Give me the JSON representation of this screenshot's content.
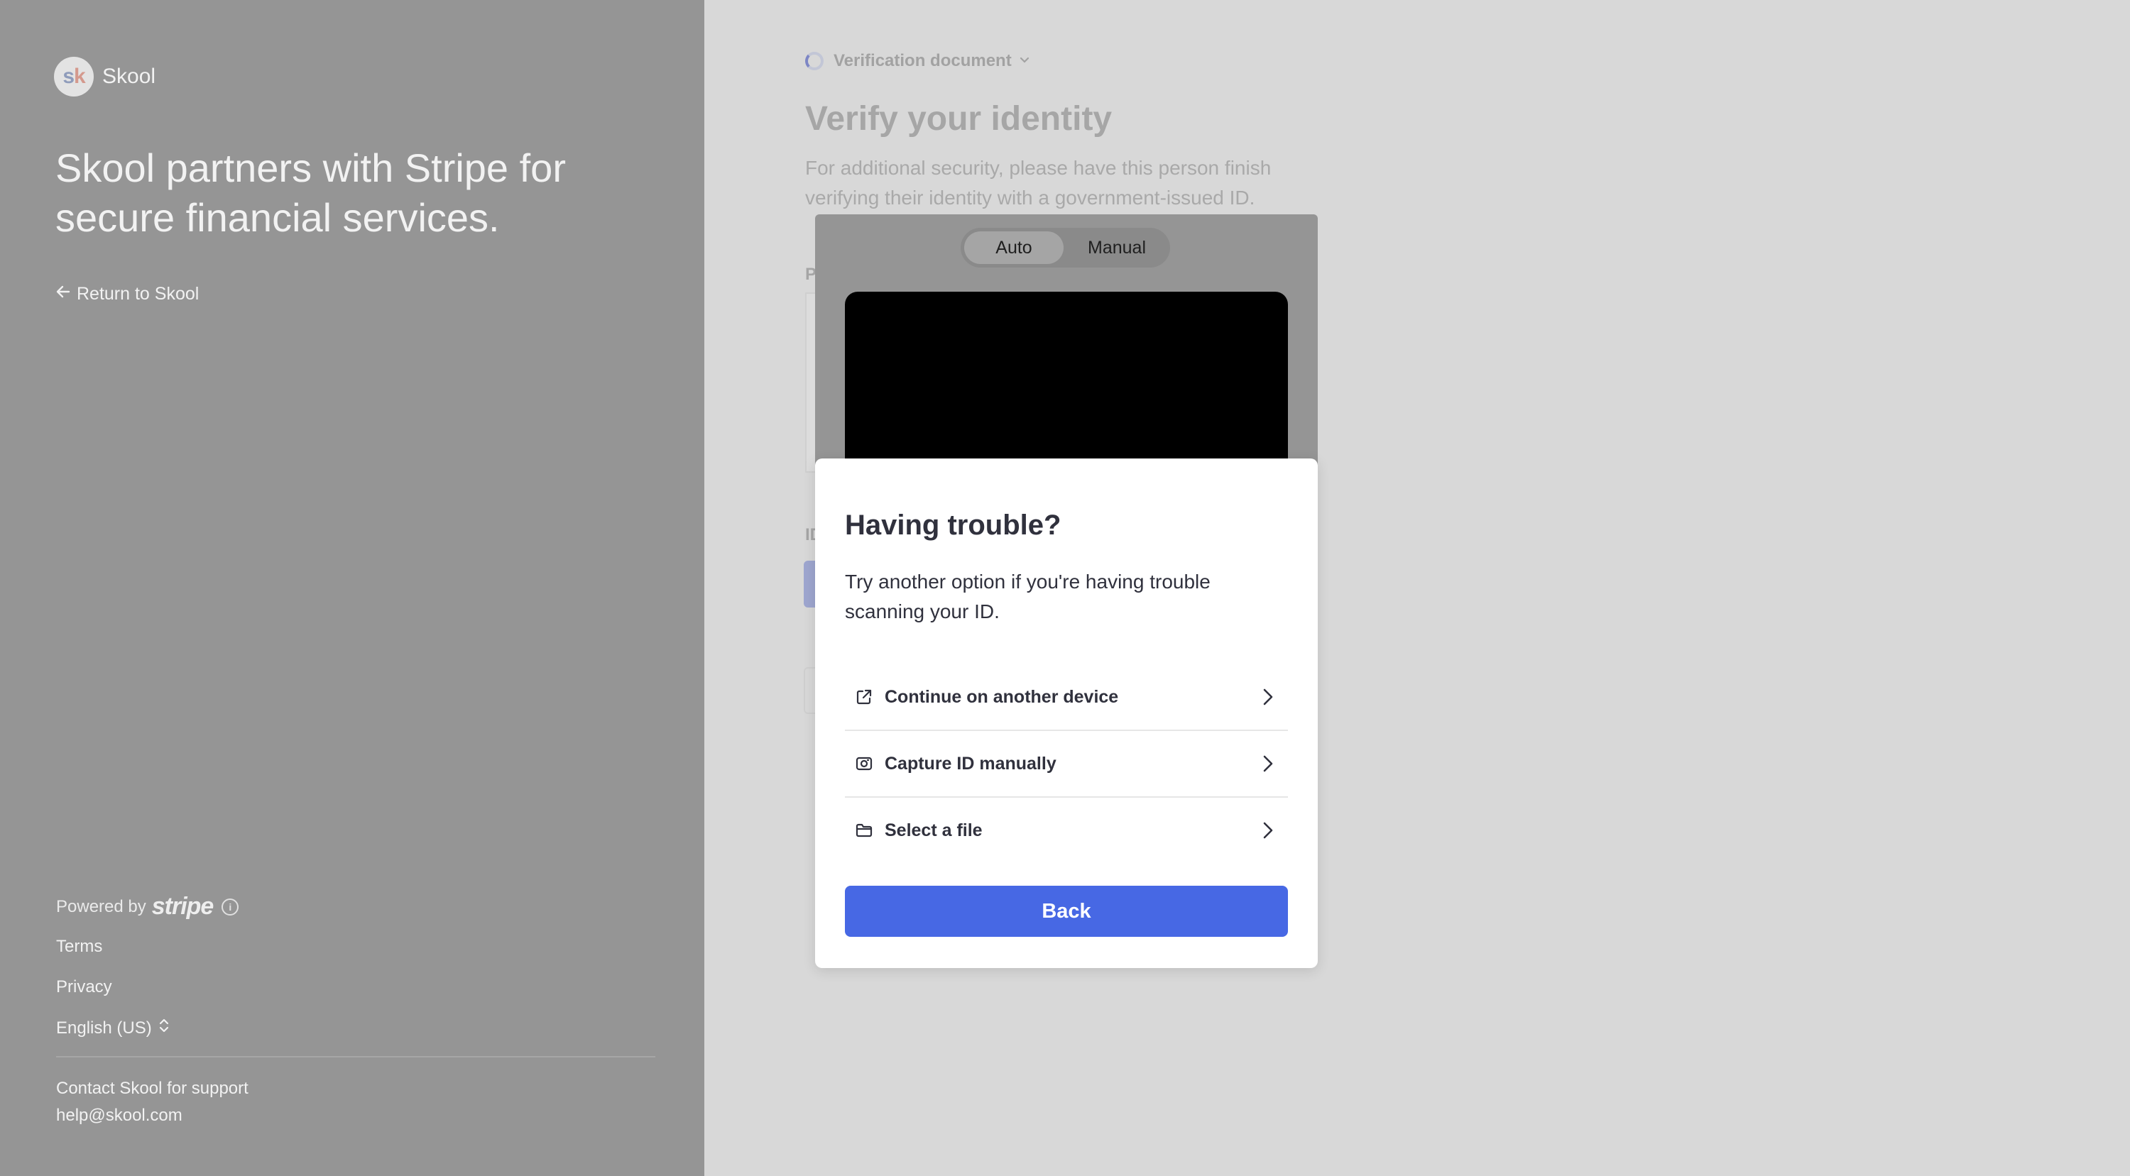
{
  "brand": {
    "logo_s": "s",
    "logo_k": "k",
    "name": "Skool"
  },
  "left": {
    "headline": "Skool partners with Stripe for secure financial services.",
    "return_link": "Return to Skool",
    "powered_by": "Powered by",
    "powered_brand": "stripe",
    "terms": "Terms",
    "privacy": "Privacy",
    "language": "English (US)",
    "support_text": "Contact Skool for support",
    "support_email": "help@skool.com"
  },
  "page": {
    "step_label": "Verification document",
    "title": "Verify your identity",
    "description": "For additional security, please have this person finish verifying their identity with a government-issued ID.",
    "stub_p": "P",
    "stub_id": "ID"
  },
  "camera": {
    "toggle": {
      "auto": "Auto",
      "manual": "Manual",
      "selected": "Auto"
    }
  },
  "modal": {
    "title": "Having trouble?",
    "description": "Try another option if you're having trouble scanning your ID.",
    "options": [
      {
        "label": "Continue on another device",
        "icon": "external-link-icon"
      },
      {
        "label": "Capture ID manually",
        "icon": "camera-icon"
      },
      {
        "label": "Select a file",
        "icon": "folder-icon"
      }
    ],
    "back_label": "Back"
  },
  "colors": {
    "accent": "#4768e4",
    "left_panel": "#959595",
    "overlay_bg": "#d8d8d8",
    "text_dark": "#30313d"
  }
}
